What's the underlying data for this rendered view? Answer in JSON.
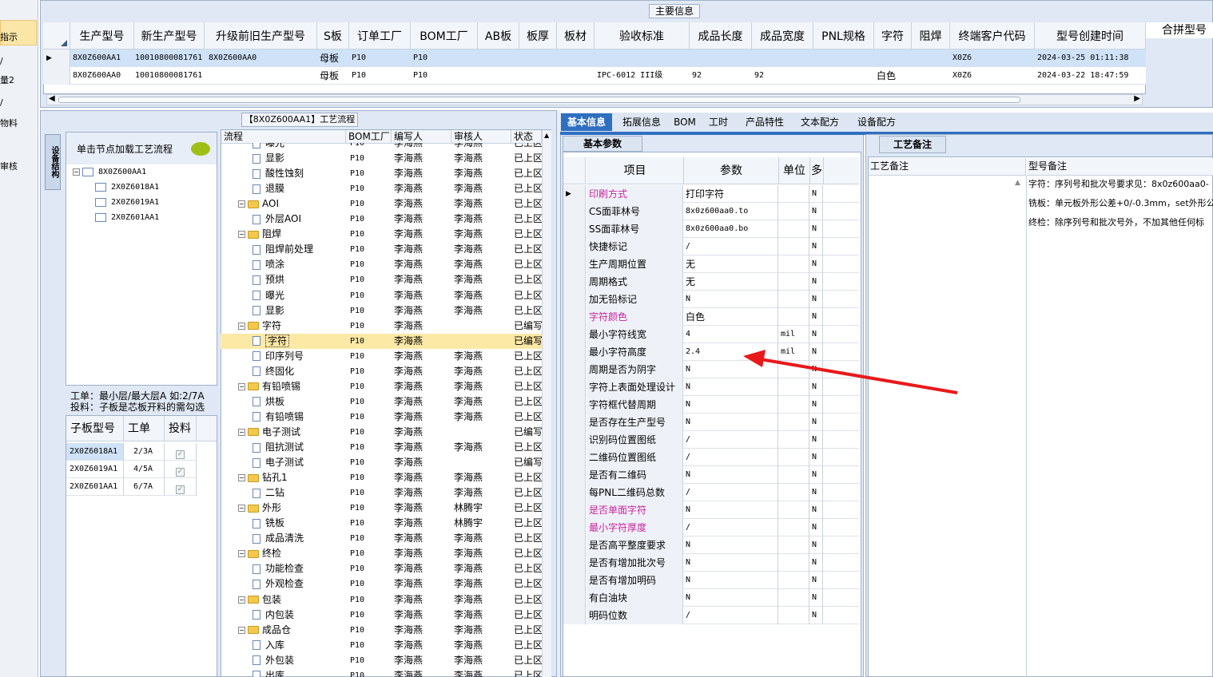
{
  "left_strip": {
    "items": [
      "指示",
      "/",
      "量2",
      "/",
      "物料",
      "审核"
    ]
  },
  "top_panel": {
    "group_label": "主要信息",
    "columns": [
      "生产型号",
      "新生产型号",
      "升级前旧生产型号",
      "S板",
      "订单工厂",
      "BOM工厂",
      "AB板",
      "板厚",
      "板材",
      "验收标准",
      "成品长度",
      "成品宽度",
      "PNL规格",
      "字符",
      "阻焊",
      "终端客户代码",
      "型号创建时间"
    ],
    "extra_column": "合拼型号",
    "rows": [
      {
        "values": [
          "8X0Z600AA1",
          "10010800081761",
          "8X0Z600AA0",
          "母板",
          "P10",
          "P10",
          "",
          "",
          "",
          "",
          "",
          "",
          "",
          "",
          "",
          "X0Z6",
          "2024-03-25 01:11:38"
        ],
        "selected": true
      },
      {
        "values": [
          "8X0Z600AA0",
          "10010800081761",
          "",
          "母板",
          "P10",
          "P10",
          "",
          "",
          "",
          "IPC-6012 III级",
          "92",
          "92",
          "",
          "白色",
          "",
          "X0Z6",
          "2024-03-22 18:47:59"
        ],
        "selected": false
      }
    ]
  },
  "process_panel": {
    "title": "【8X0Z600AA1】工艺流程",
    "side_tab": "设备结构",
    "load_hint": "单击节点加载工艺流程",
    "tree_root": "8X0Z600AA1",
    "tree_children": [
      "2X0Z6018A1",
      "2X0Z6019A1",
      "2X0Z601AA1"
    ],
    "info_line1": "工单：最小层/最大层A 如:2/7A",
    "info_line2": "投料：子板是芯板开料的需勾选",
    "sub_columns": [
      "子板型号",
      "工单",
      "投料"
    ],
    "sub_rows": [
      {
        "model": "2X0Z6018A1",
        "order": "2/3A",
        "checked": "✓"
      },
      {
        "model": "2X0Z6019A1",
        "order": "4/5A",
        "checked": "✓"
      },
      {
        "model": "2X0Z601AA1",
        "order": "6/7A",
        "checked": "✓"
      }
    ],
    "flow_columns": [
      "流程",
      "BOM工厂",
      "编写人",
      "审核人",
      "状态"
    ],
    "flow_rows": [
      {
        "name": "曝光",
        "level": 2,
        "folder": false,
        "bom": "P10",
        "writer": "李海燕",
        "reviewer": "李海燕",
        "status": "已上区"
      },
      {
        "name": "显影",
        "level": 2,
        "folder": false,
        "bom": "P10",
        "writer": "李海燕",
        "reviewer": "李海燕",
        "status": "已上区"
      },
      {
        "name": "酸性蚀刻",
        "level": 2,
        "folder": false,
        "bom": "P10",
        "writer": "李海燕",
        "reviewer": "李海燕",
        "status": "已上区"
      },
      {
        "name": "退膜",
        "level": 2,
        "folder": false,
        "bom": "P10",
        "writer": "李海燕",
        "reviewer": "李海燕",
        "status": "已上区"
      },
      {
        "name": "AOI",
        "level": 1,
        "folder": true,
        "bom": "P10",
        "writer": "李海燕",
        "reviewer": "李海燕",
        "status": "已上区"
      },
      {
        "name": "外层AOI",
        "level": 2,
        "folder": false,
        "bom": "P10",
        "writer": "李海燕",
        "reviewer": "李海燕",
        "status": "已上区"
      },
      {
        "name": "阻焊",
        "level": 1,
        "folder": true,
        "bom": "P10",
        "writer": "李海燕",
        "reviewer": "李海燕",
        "status": "已上区"
      },
      {
        "name": "阻焊前处理",
        "level": 2,
        "folder": false,
        "bom": "P10",
        "writer": "李海燕",
        "reviewer": "李海燕",
        "status": "已上区"
      },
      {
        "name": "喷涂",
        "level": 2,
        "folder": false,
        "bom": "P10",
        "writer": "李海燕",
        "reviewer": "李海燕",
        "status": "已上区"
      },
      {
        "name": "预烘",
        "level": 2,
        "folder": false,
        "bom": "P10",
        "writer": "李海燕",
        "reviewer": "李海燕",
        "status": "已上区"
      },
      {
        "name": "曝光",
        "level": 2,
        "folder": false,
        "bom": "P10",
        "writer": "李海燕",
        "reviewer": "李海燕",
        "status": "已上区"
      },
      {
        "name": "显影",
        "level": 2,
        "folder": false,
        "bom": "P10",
        "writer": "李海燕",
        "reviewer": "李海燕",
        "status": "已上区"
      },
      {
        "name": "字符",
        "level": 1,
        "folder": true,
        "bom": "P10",
        "writer": "李海燕",
        "reviewer": "",
        "status": "已编写"
      },
      {
        "name": "字符",
        "level": 2,
        "folder": false,
        "bom": "P10",
        "writer": "李海燕",
        "reviewer": "",
        "status": "已编写",
        "selected": true
      },
      {
        "name": "印序列号",
        "level": 2,
        "folder": false,
        "bom": "P10",
        "writer": "李海燕",
        "reviewer": "李海燕",
        "status": "已上区"
      },
      {
        "name": "终固化",
        "level": 2,
        "folder": false,
        "bom": "P10",
        "writer": "李海燕",
        "reviewer": "李海燕",
        "status": "已上区"
      },
      {
        "name": "有铅喷锡",
        "level": 1,
        "folder": true,
        "bom": "P10",
        "writer": "李海燕",
        "reviewer": "李海燕",
        "status": "已上区"
      },
      {
        "name": "烘板",
        "level": 2,
        "folder": false,
        "bom": "P10",
        "writer": "李海燕",
        "reviewer": "李海燕",
        "status": "已上区"
      },
      {
        "name": "有铅喷锡",
        "level": 2,
        "folder": false,
        "bom": "P10",
        "writer": "李海燕",
        "reviewer": "李海燕",
        "status": "已上区"
      },
      {
        "name": "电子测试",
        "level": 1,
        "folder": true,
        "bom": "P10",
        "writer": "李海燕",
        "reviewer": "",
        "status": "已编写"
      },
      {
        "name": "阻抗测试",
        "level": 2,
        "folder": false,
        "bom": "P10",
        "writer": "李海燕",
        "reviewer": "李海燕",
        "status": "已上区"
      },
      {
        "name": "电子测试",
        "level": 2,
        "folder": false,
        "bom": "P10",
        "writer": "李海燕",
        "reviewer": "",
        "status": "已编写"
      },
      {
        "name": "钻孔1",
        "level": 1,
        "folder": true,
        "bom": "P10",
        "writer": "李海燕",
        "reviewer": "李海燕",
        "status": "已上区"
      },
      {
        "name": "二钻",
        "level": 2,
        "folder": false,
        "bom": "P10",
        "writer": "李海燕",
        "reviewer": "李海燕",
        "status": "已上区"
      },
      {
        "name": "外形",
        "level": 1,
        "folder": true,
        "bom": "P10",
        "writer": "李海燕",
        "reviewer": "林腾宇",
        "status": "已上区"
      },
      {
        "name": "铣板",
        "level": 2,
        "folder": false,
        "bom": "P10",
        "writer": "李海燕",
        "reviewer": "林腾宇",
        "status": "已上区"
      },
      {
        "name": "成品清洗",
        "level": 2,
        "folder": false,
        "bom": "P10",
        "writer": "李海燕",
        "reviewer": "李海燕",
        "status": "已上区"
      },
      {
        "name": "终检",
        "level": 1,
        "folder": true,
        "bom": "P10",
        "writer": "李海燕",
        "reviewer": "李海燕",
        "status": "已上区"
      },
      {
        "name": "功能检查",
        "level": 2,
        "folder": false,
        "bom": "P10",
        "writer": "李海燕",
        "reviewer": "李海燕",
        "status": "已上区"
      },
      {
        "name": "外观检查",
        "level": 2,
        "folder": false,
        "bom": "P10",
        "writer": "李海燕",
        "reviewer": "李海燕",
        "status": "已上区"
      },
      {
        "name": "包装",
        "level": 1,
        "folder": true,
        "bom": "P10",
        "writer": "李海燕",
        "reviewer": "李海燕",
        "status": "已上区"
      },
      {
        "name": "内包装",
        "level": 2,
        "folder": false,
        "bom": "P10",
        "writer": "李海燕",
        "reviewer": "李海燕",
        "status": "已上区"
      },
      {
        "name": "成品仓",
        "level": 1,
        "folder": true,
        "bom": "P10",
        "writer": "李海燕",
        "reviewer": "李海燕",
        "status": "已上区"
      },
      {
        "name": "入库",
        "level": 2,
        "folder": false,
        "bom": "P10",
        "writer": "李海燕",
        "reviewer": "李海燕",
        "status": "已上区"
      },
      {
        "name": "外包装",
        "level": 2,
        "folder": false,
        "bom": "P10",
        "writer": "李海燕",
        "reviewer": "李海燕",
        "status": "已上区"
      },
      {
        "name": "出库",
        "level": 2,
        "folder": false,
        "bom": "P10",
        "writer": "李海燕",
        "reviewer": "李海燕",
        "status": "已上区"
      }
    ]
  },
  "detail_panel": {
    "tabs": [
      "基本信息",
      "拓展信息",
      "BOM",
      "工时",
      "产品特性",
      "文本配方",
      "设备配方"
    ],
    "active_tab": "基本信息",
    "subtab": "基本参数",
    "columns": [
      "项目",
      "参数",
      "单位",
      "多"
    ],
    "params": [
      {
        "item": "印刷方式",
        "value": "打印字符",
        "unit": "",
        "flag": "N",
        "pink": true
      },
      {
        "item": "CS面菲林号",
        "value": "8x0z600aa0.to",
        "unit": "",
        "flag": "N",
        "pink": false
      },
      {
        "item": "SS面菲林号",
        "value": "8x0z600aa0.bo",
        "unit": "",
        "flag": "N",
        "pink": false
      },
      {
        "item": "快捷标记",
        "value": "/",
        "unit": "",
        "flag": "N",
        "pink": false
      },
      {
        "item": "生产周期位置",
        "value": "无",
        "unit": "",
        "flag": "N",
        "pink": false
      },
      {
        "item": "周期格式",
        "value": "无",
        "unit": "",
        "flag": "N",
        "pink": false
      },
      {
        "item": "加无铅标记",
        "value": "N",
        "unit": "",
        "flag": "N",
        "pink": false
      },
      {
        "item": "字符颜色",
        "value": "白色",
        "unit": "",
        "flag": "N",
        "pink": true
      },
      {
        "item": "最小字符线宽",
        "value": "4",
        "unit": "mil",
        "flag": "N",
        "pink": false
      },
      {
        "item": "最小字符高度",
        "value": "2.4",
        "unit": "mil",
        "flag": "N",
        "pink": false
      },
      {
        "item": "周期是否为阴字",
        "value": "N",
        "unit": "",
        "flag": "N",
        "pink": false
      },
      {
        "item": "字符上表面处理设计",
        "value": "N",
        "unit": "",
        "flag": "N",
        "pink": false
      },
      {
        "item": "字符框代替周期",
        "value": "N",
        "unit": "",
        "flag": "N",
        "pink": false
      },
      {
        "item": "是否存在生产型号",
        "value": "N",
        "unit": "",
        "flag": "N",
        "pink": false
      },
      {
        "item": "识别码位置图纸",
        "value": "/",
        "unit": "",
        "flag": "N",
        "pink": false
      },
      {
        "item": "二维码位置图纸",
        "value": "/",
        "unit": "",
        "flag": "N",
        "pink": false
      },
      {
        "item": "是否有二维码",
        "value": "N",
        "unit": "",
        "flag": "N",
        "pink": false
      },
      {
        "item": "每PNL二维码总数",
        "value": "/",
        "unit": "",
        "flag": "N",
        "pink": false
      },
      {
        "item": "是否单面字符",
        "value": "N",
        "unit": "",
        "flag": "N",
        "pink": true
      },
      {
        "item": "最小字符厚度",
        "value": "/",
        "unit": "",
        "flag": "N",
        "pink": true
      },
      {
        "item": "是否高平整度要求",
        "value": "N",
        "unit": "",
        "flag": "N",
        "pink": false
      },
      {
        "item": "是否有增加批次号",
        "value": "N",
        "unit": "",
        "flag": "N",
        "pink": false
      },
      {
        "item": "是否有增加明码",
        "value": "N",
        "unit": "",
        "flag": "N",
        "pink": false
      },
      {
        "item": "有白油块",
        "value": "N",
        "unit": "",
        "flag": "N",
        "pink": false
      },
      {
        "item": "明码位数",
        "value": "/",
        "unit": "",
        "flag": "N",
        "pink": false
      }
    ]
  },
  "notes_panel": {
    "tab": "工艺备注",
    "col1": "工艺备注",
    "col2": "型号备注",
    "notes": [
      "字符：序列号和批次号要求见：8x0z600aa0-",
      "铣板：单元板外形公差+0/-0.3mm，set外形公",
      "终检：除序列号和批次号外，不加其他任何标"
    ]
  },
  "colors": {
    "accent": "#2f6fc1",
    "selected_row": "#cfe2f8",
    "highlight": "#fde9a6",
    "annotation_arrow": "#e8191a"
  }
}
